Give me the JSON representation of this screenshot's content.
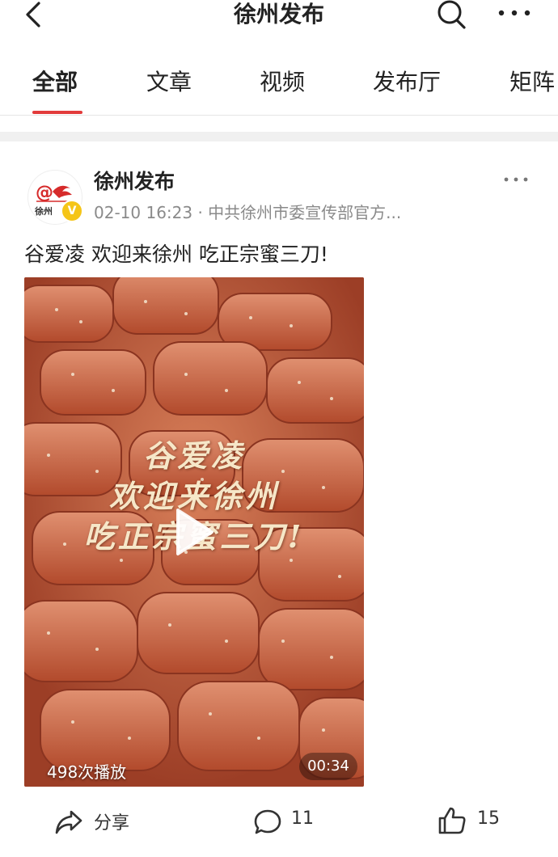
{
  "header": {
    "title": "徐州发布",
    "back_icon": "chevron-left-icon",
    "search_icon": "search-icon",
    "more_icon": "more-icon"
  },
  "tabs": [
    {
      "label": "全部",
      "active": true
    },
    {
      "label": "文章",
      "active": false
    },
    {
      "label": "视频",
      "active": false
    },
    {
      "label": "发布厅",
      "active": false
    },
    {
      "label": "矩阵",
      "active": false
    }
  ],
  "colors": {
    "accent": "#e23b3b",
    "verified": "#f5c518"
  },
  "post": {
    "author": "徐州发布",
    "avatar_text": "徐州",
    "verified_label": "V",
    "meta": "02-10 16:23 · 中共徐州市委宣传部官方...",
    "caption": "谷爱凌 欢迎来徐州 吃正宗蜜三刀!",
    "video": {
      "overlay_lines": [
        "谷爱凌",
        "欢迎来徐州",
        "吃正宗蜜三刀!"
      ],
      "play_count": "498次播放",
      "duration": "00:34"
    },
    "actions": {
      "share_label": "分享",
      "comment_count": "11",
      "like_count": "15"
    }
  }
}
